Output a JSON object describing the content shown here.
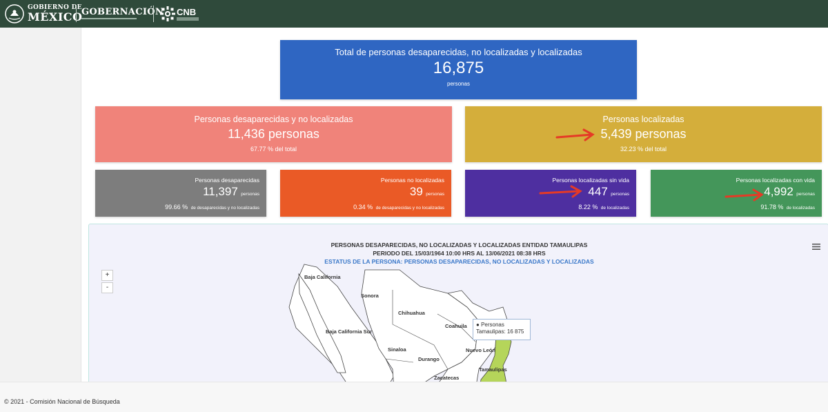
{
  "header": {
    "gov_line1": "GOBIERNO DE",
    "gov_line2": "MÉXICO",
    "gobernacion": "GOBERNACIÓN",
    "cnb": "CNB"
  },
  "total": {
    "title": "Total de personas desaparecidas, no localizadas y localizadas",
    "value": "16,875",
    "unit": "personas"
  },
  "desaparecidas_nolocalizadas": {
    "title": "Personas desaparecidas y no localizadas",
    "value": "11,436 personas",
    "pct": "67.77 % del total",
    "color": "#f0837a"
  },
  "localizadas": {
    "title": "Personas localizadas",
    "value": "5,439 personas",
    "pct": "32.23 % del total",
    "color": "#d4ae3b"
  },
  "small_cards": [
    {
      "title": "Personas desaparecidas",
      "value": "11,397",
      "unit": "personas",
      "pct": "99.66 %",
      "pct_label": "de desaparecidas y no localizadas",
      "color": "#7d7d7d"
    },
    {
      "title": "Personas no localizadas",
      "value": "39",
      "unit": "personas",
      "pct": "0.34 %",
      "pct_label": "de desaparecidas y no localizadas",
      "color": "#ea5a26"
    },
    {
      "title": "Personas localizadas sin vida",
      "value": "447",
      "unit": "personas",
      "pct": "8.22 %",
      "pct_label": "de localizadas",
      "color": "#4e2fa0"
    },
    {
      "title": "Personas localizadas con vida",
      "value": "4,992",
      "unit": "personas",
      "pct": "91.78 %",
      "pct_label": "de localizadas",
      "color": "#44965a"
    }
  ],
  "map": {
    "title1": "PERSONAS DESAPARECIDAS, NO LOCALIZADAS Y LOCALIZADAS ENTIDAD TAMAULIPAS",
    "title2": "PERIODO DEL 15/03/1964 10:00 HRS AL 13/06/2021 08:38 HRS",
    "title3": "ESTATUS DE LA PERSONA: PERSONAS DESAPARECIDAS, NO LOCALIZADAS Y LOCALIZADAS",
    "zoom_in": "+",
    "zoom_out": "-",
    "states": [
      "Baja California",
      "Sonora",
      "Chihuahua",
      "Coahuila",
      "Baja California Sur",
      "Sinaloa",
      "Durango",
      "Nuevo León",
      "Tamaulipas",
      "Zacatecas"
    ],
    "tooltip_series": "Personas",
    "tooltip_value": "Tamaulipas: 16 875",
    "highlight_color": "#b5d55a"
  },
  "footer": {
    "text": "© 2021 - Comisión Nacional de Búsqueda"
  },
  "colors": {
    "header": "#2f4a3b",
    "total": "#2f66c2",
    "arrow": "#e53a26"
  }
}
